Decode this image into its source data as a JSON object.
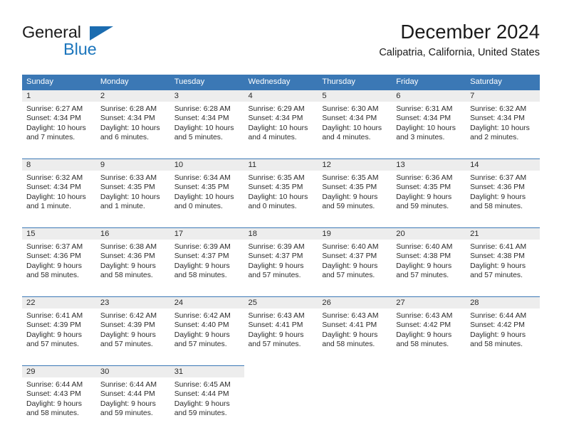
{
  "brand": {
    "name_part1": "General",
    "name_part2": "Blue",
    "triangle_color": "#1b6cb0",
    "blue_color": "#1b75bc"
  },
  "header": {
    "title": "December 2024",
    "subtitle": "Calipatria, California, United States"
  },
  "theme": {
    "header_row_bg": "#3b78b5",
    "header_row_text": "#ffffff",
    "daynum_strip_bg": "#ededed",
    "cell_bg": "#ffffff",
    "body_text": "#2b2b2b",
    "grid_line": "#3b78b5"
  },
  "weekday_headers": [
    "Sunday",
    "Monday",
    "Tuesday",
    "Wednesday",
    "Thursday",
    "Friday",
    "Saturday"
  ],
  "labels": {
    "sunrise_prefix": "Sunrise:",
    "sunset_prefix": "Sunset:",
    "daylight_prefix": "Daylight:"
  },
  "weeks": [
    [
      {
        "day": "1",
        "sunrise": "Sunrise: 6:27 AM",
        "sunset": "Sunset: 4:34 PM",
        "daylight1": "Daylight: 10 hours",
        "daylight2": "and 7 minutes."
      },
      {
        "day": "2",
        "sunrise": "Sunrise: 6:28 AM",
        "sunset": "Sunset: 4:34 PM",
        "daylight1": "Daylight: 10 hours",
        "daylight2": "and 6 minutes."
      },
      {
        "day": "3",
        "sunrise": "Sunrise: 6:28 AM",
        "sunset": "Sunset: 4:34 PM",
        "daylight1": "Daylight: 10 hours",
        "daylight2": "and 5 minutes."
      },
      {
        "day": "4",
        "sunrise": "Sunrise: 6:29 AM",
        "sunset": "Sunset: 4:34 PM",
        "daylight1": "Daylight: 10 hours",
        "daylight2": "and 4 minutes."
      },
      {
        "day": "5",
        "sunrise": "Sunrise: 6:30 AM",
        "sunset": "Sunset: 4:34 PM",
        "daylight1": "Daylight: 10 hours",
        "daylight2": "and 4 minutes."
      },
      {
        "day": "6",
        "sunrise": "Sunrise: 6:31 AM",
        "sunset": "Sunset: 4:34 PM",
        "daylight1": "Daylight: 10 hours",
        "daylight2": "and 3 minutes."
      },
      {
        "day": "7",
        "sunrise": "Sunrise: 6:32 AM",
        "sunset": "Sunset: 4:34 PM",
        "daylight1": "Daylight: 10 hours",
        "daylight2": "and 2 minutes."
      }
    ],
    [
      {
        "day": "8",
        "sunrise": "Sunrise: 6:32 AM",
        "sunset": "Sunset: 4:34 PM",
        "daylight1": "Daylight: 10 hours",
        "daylight2": "and 1 minute."
      },
      {
        "day": "9",
        "sunrise": "Sunrise: 6:33 AM",
        "sunset": "Sunset: 4:35 PM",
        "daylight1": "Daylight: 10 hours",
        "daylight2": "and 1 minute."
      },
      {
        "day": "10",
        "sunrise": "Sunrise: 6:34 AM",
        "sunset": "Sunset: 4:35 PM",
        "daylight1": "Daylight: 10 hours",
        "daylight2": "and 0 minutes."
      },
      {
        "day": "11",
        "sunrise": "Sunrise: 6:35 AM",
        "sunset": "Sunset: 4:35 PM",
        "daylight1": "Daylight: 10 hours",
        "daylight2": "and 0 minutes."
      },
      {
        "day": "12",
        "sunrise": "Sunrise: 6:35 AM",
        "sunset": "Sunset: 4:35 PM",
        "daylight1": "Daylight: 9 hours",
        "daylight2": "and 59 minutes."
      },
      {
        "day": "13",
        "sunrise": "Sunrise: 6:36 AM",
        "sunset": "Sunset: 4:35 PM",
        "daylight1": "Daylight: 9 hours",
        "daylight2": "and 59 minutes."
      },
      {
        "day": "14",
        "sunrise": "Sunrise: 6:37 AM",
        "sunset": "Sunset: 4:36 PM",
        "daylight1": "Daylight: 9 hours",
        "daylight2": "and 58 minutes."
      }
    ],
    [
      {
        "day": "15",
        "sunrise": "Sunrise: 6:37 AM",
        "sunset": "Sunset: 4:36 PM",
        "daylight1": "Daylight: 9 hours",
        "daylight2": "and 58 minutes."
      },
      {
        "day": "16",
        "sunrise": "Sunrise: 6:38 AM",
        "sunset": "Sunset: 4:36 PM",
        "daylight1": "Daylight: 9 hours",
        "daylight2": "and 58 minutes."
      },
      {
        "day": "17",
        "sunrise": "Sunrise: 6:39 AM",
        "sunset": "Sunset: 4:37 PM",
        "daylight1": "Daylight: 9 hours",
        "daylight2": "and 58 minutes."
      },
      {
        "day": "18",
        "sunrise": "Sunrise: 6:39 AM",
        "sunset": "Sunset: 4:37 PM",
        "daylight1": "Daylight: 9 hours",
        "daylight2": "and 57 minutes."
      },
      {
        "day": "19",
        "sunrise": "Sunrise: 6:40 AM",
        "sunset": "Sunset: 4:37 PM",
        "daylight1": "Daylight: 9 hours",
        "daylight2": "and 57 minutes."
      },
      {
        "day": "20",
        "sunrise": "Sunrise: 6:40 AM",
        "sunset": "Sunset: 4:38 PM",
        "daylight1": "Daylight: 9 hours",
        "daylight2": "and 57 minutes."
      },
      {
        "day": "21",
        "sunrise": "Sunrise: 6:41 AM",
        "sunset": "Sunset: 4:38 PM",
        "daylight1": "Daylight: 9 hours",
        "daylight2": "and 57 minutes."
      }
    ],
    [
      {
        "day": "22",
        "sunrise": "Sunrise: 6:41 AM",
        "sunset": "Sunset: 4:39 PM",
        "daylight1": "Daylight: 9 hours",
        "daylight2": "and 57 minutes."
      },
      {
        "day": "23",
        "sunrise": "Sunrise: 6:42 AM",
        "sunset": "Sunset: 4:39 PM",
        "daylight1": "Daylight: 9 hours",
        "daylight2": "and 57 minutes."
      },
      {
        "day": "24",
        "sunrise": "Sunrise: 6:42 AM",
        "sunset": "Sunset: 4:40 PM",
        "daylight1": "Daylight: 9 hours",
        "daylight2": "and 57 minutes."
      },
      {
        "day": "25",
        "sunrise": "Sunrise: 6:43 AM",
        "sunset": "Sunset: 4:41 PM",
        "daylight1": "Daylight: 9 hours",
        "daylight2": "and 57 minutes."
      },
      {
        "day": "26",
        "sunrise": "Sunrise: 6:43 AM",
        "sunset": "Sunset: 4:41 PM",
        "daylight1": "Daylight: 9 hours",
        "daylight2": "and 58 minutes."
      },
      {
        "day": "27",
        "sunrise": "Sunrise: 6:43 AM",
        "sunset": "Sunset: 4:42 PM",
        "daylight1": "Daylight: 9 hours",
        "daylight2": "and 58 minutes."
      },
      {
        "day": "28",
        "sunrise": "Sunrise: 6:44 AM",
        "sunset": "Sunset: 4:42 PM",
        "daylight1": "Daylight: 9 hours",
        "daylight2": "and 58 minutes."
      }
    ],
    [
      {
        "day": "29",
        "sunrise": "Sunrise: 6:44 AM",
        "sunset": "Sunset: 4:43 PM",
        "daylight1": "Daylight: 9 hours",
        "daylight2": "and 58 minutes."
      },
      {
        "day": "30",
        "sunrise": "Sunrise: 6:44 AM",
        "sunset": "Sunset: 4:44 PM",
        "daylight1": "Daylight: 9 hours",
        "daylight2": "and 59 minutes."
      },
      {
        "day": "31",
        "sunrise": "Sunrise: 6:45 AM",
        "sunset": "Sunset: 4:44 PM",
        "daylight1": "Daylight: 9 hours",
        "daylight2": "and 59 minutes."
      },
      {
        "day": "",
        "sunrise": "",
        "sunset": "",
        "daylight1": "",
        "daylight2": ""
      },
      {
        "day": "",
        "sunrise": "",
        "sunset": "",
        "daylight1": "",
        "daylight2": ""
      },
      {
        "day": "",
        "sunrise": "",
        "sunset": "",
        "daylight1": "",
        "daylight2": ""
      },
      {
        "day": "",
        "sunrise": "",
        "sunset": "",
        "daylight1": "",
        "daylight2": ""
      }
    ]
  ]
}
